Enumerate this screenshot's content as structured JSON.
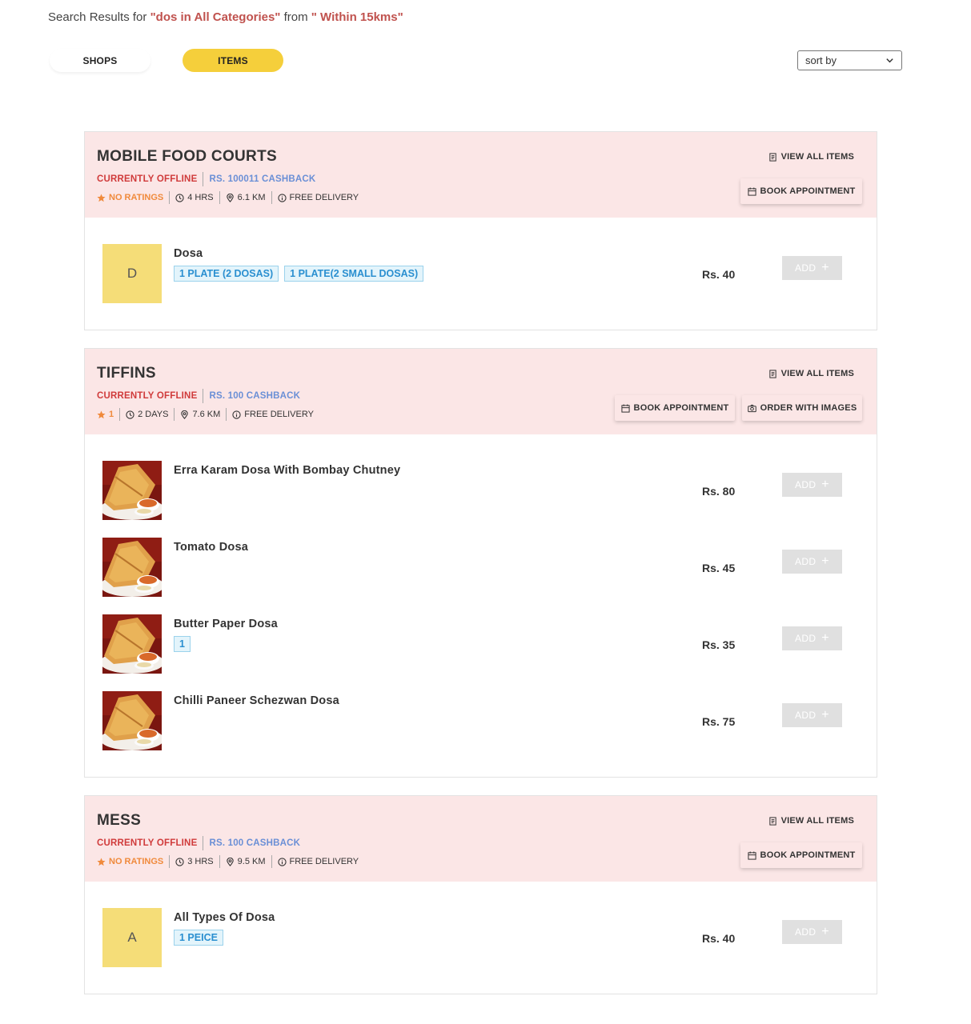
{
  "search": {
    "prefix": "Search Results for ",
    "query": "\"dos in All Categories\"",
    "middle": " from ",
    "range": "\" Within 15kms\""
  },
  "tabs": {
    "shops": "SHOPS",
    "items": "ITEMS"
  },
  "sort": {
    "label": "sort by"
  },
  "colors": {
    "accent": "#f5cf3b",
    "header_bg": "#fbe6e6",
    "offline": "#d03b3b",
    "cashback": "#6a8fd6",
    "rating": "#f08a3c",
    "variant_text": "#2a8fd0"
  },
  "shops": [
    {
      "name": "MOBILE FOOD COURTS",
      "status": "CURRENTLY OFFLINE",
      "cashback": "RS. 100011 CASHBACK",
      "rating": "NO RATINGS",
      "time": "4 HRS",
      "distance": "6.1 KM",
      "delivery": "FREE DELIVERY",
      "view_all": "VIEW ALL ITEMS",
      "book": "BOOK APPOINTMENT",
      "items": [
        {
          "name": "Dosa",
          "thumb": "D",
          "variants": [
            "1 PLATE (2 DOSAS)",
            "1 PLATE(2 SMALL DOSAS)"
          ],
          "price": "Rs. 40",
          "add": "ADD"
        }
      ]
    },
    {
      "name": "TIFFINS",
      "status": "CURRENTLY OFFLINE",
      "cashback": "RS. 100 CASHBACK",
      "rating": "1",
      "time": "2 DAYS",
      "distance": "7.6 KM",
      "delivery": "FREE DELIVERY",
      "view_all": "VIEW ALL ITEMS",
      "book": "BOOK APPOINTMENT",
      "order_images": "ORDER WITH IMAGES",
      "items": [
        {
          "name": "Erra Karam Dosa With Bombay Chutney",
          "price": "Rs. 80",
          "add": "ADD",
          "image": "dosa-photo"
        },
        {
          "name": "Tomato Dosa",
          "price": "Rs. 45",
          "add": "ADD",
          "image": "dosa-photo"
        },
        {
          "name": "Butter Paper Dosa",
          "variants": [
            "1"
          ],
          "price": "Rs. 35",
          "add": "ADD",
          "image": "dosa-photo"
        },
        {
          "name": "Chilli Paneer Schezwan Dosa",
          "price": "Rs. 75",
          "add": "ADD",
          "image": "dosa-photo"
        }
      ]
    },
    {
      "name": "MESS",
      "status": "CURRENTLY OFFLINE",
      "cashback": "RS. 100 CASHBACK",
      "rating": "NO RATINGS",
      "time": "3 HRS",
      "distance": "9.5 KM",
      "delivery": "FREE DELIVERY",
      "view_all": "VIEW ALL ITEMS",
      "book": "BOOK APPOINTMENT",
      "items": [
        {
          "name": "All Types Of Dosa",
          "thumb": "A",
          "variants": [
            "1 PEICE"
          ],
          "price": "Rs. 40",
          "add": "ADD"
        }
      ]
    }
  ]
}
